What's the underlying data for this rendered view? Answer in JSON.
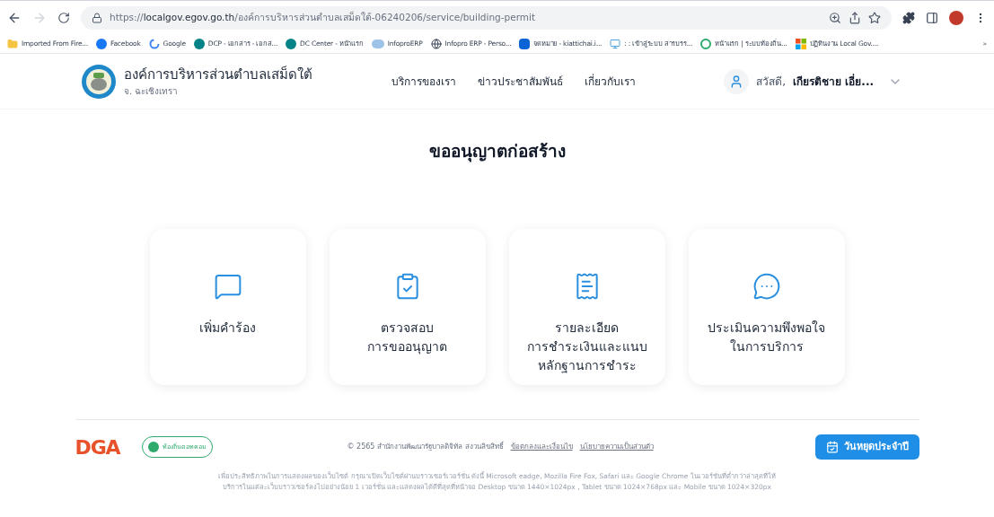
{
  "browser": {
    "url_scheme": "https://",
    "url_host": "localgov.egov.go.th",
    "url_path": "/องค์การบริหารส่วนตำบลเสม็ดใต้-06240206/service/building-permit",
    "bookmarks": [
      {
        "label": "Imported From Fire...",
        "kind": "folder"
      },
      {
        "label": "Facebook",
        "kind": "facebook"
      },
      {
        "label": "Google",
        "kind": "google"
      },
      {
        "label": "DCP - เอกสาร - เอกส...",
        "kind": "sharepoint"
      },
      {
        "label": "DC Center - หน้าแรก",
        "kind": "sharepoint"
      },
      {
        "label": "InfoproERP",
        "kind": "erp"
      },
      {
        "label": "Infopro ERP - Perso...",
        "kind": "globe"
      },
      {
        "label": "จดหมาย - kiattichai.i...",
        "kind": "outlook"
      },
      {
        "label": ": : เข้าสู่ระบบ สารบรร...",
        "kind": "monitor"
      },
      {
        "label": "หน้าแรก | ระบบท้องถิ่น...",
        "kind": "circle"
      },
      {
        "label": "ปฏิทินงาน Local Gov....",
        "kind": "windows"
      }
    ],
    "more": "»"
  },
  "header": {
    "org_name": "องค์การบริหารส่วนตำบลเสม็ดใต้",
    "province": "จ. ฉะเชิงเทรา",
    "nav": [
      "บริการของเรา",
      "ข่าวประชาสัมพันธ์",
      "เกี่ยวกับเรา"
    ],
    "greeting": "สวัสดี,",
    "user_name": "เกียรติชาย เอี่ย..."
  },
  "page_title": "ขออนุญาตก่อสร้าง",
  "cards": [
    {
      "kind": "message",
      "lines": [
        "เพิ่มคำร้อง"
      ]
    },
    {
      "kind": "clipboard",
      "lines": [
        "ตรวจสอบ",
        "การขออนุญาต"
      ]
    },
    {
      "kind": "receipt",
      "lines": [
        "รายละเอียด",
        "การชำระเงินและแนบ",
        "หลักฐานการชำระ"
      ]
    },
    {
      "kind": "chat",
      "lines": [
        "ประเมินความพึงพอใจ",
        "ในการบริการ"
      ]
    }
  ],
  "footer": {
    "dga_logo": "DGA",
    "local_logo": "ท้องถิ่นดอทคอม",
    "copyright": "© 2565 สำนักงานพัฒนารัฐบาลดิจิทัล สงวนลิขสิทธิ์",
    "links": [
      "ข้อตกลงและเงื่อนไข",
      "นโยบายความเป็นส่วนตัว"
    ],
    "holiday_button": "วันหยุดประจำปี",
    "notice": [
      "เพื่อประสิทธิภาพในการแสดงผลของเว็บไซต์ กรุณาเปิดเว็บไซต์ผ่านบราวเซอร์เวอร์ชั่น ดังนี้ Microsoft eadge, Mozilla Fire Fox, Safari และ Google Chrome ในเวอร์ชั่นที่ต่ำกว่าล่าสุดที่ให้",
      "บริการในแต่ละเว็บบราวเซอร์ลงไปอย่างน้อย 1 เวอร์ชั่น และแสดงผลได้ดีที่สุดที่หน้าจอ Desktop ขนาด 1440×1024px , Tablet ขนาด 1024×768px และ Mobile ขนาด 1024×320px"
    ]
  }
}
